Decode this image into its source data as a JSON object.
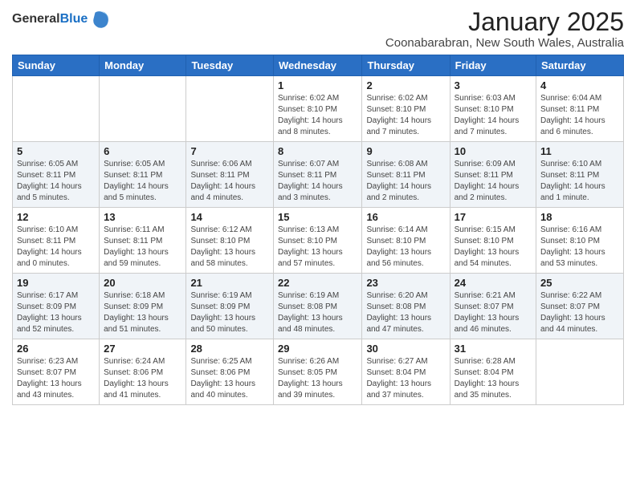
{
  "header": {
    "logo_general": "General",
    "logo_blue": "Blue",
    "month_title": "January 2025",
    "subtitle": "Coonabarabran, New South Wales, Australia"
  },
  "weekdays": [
    "Sunday",
    "Monday",
    "Tuesday",
    "Wednesday",
    "Thursday",
    "Friday",
    "Saturday"
  ],
  "weeks": [
    [
      {
        "day": "",
        "info": ""
      },
      {
        "day": "",
        "info": ""
      },
      {
        "day": "",
        "info": ""
      },
      {
        "day": "1",
        "info": "Sunrise: 6:02 AM\nSunset: 8:10 PM\nDaylight: 14 hours\nand 8 minutes."
      },
      {
        "day": "2",
        "info": "Sunrise: 6:02 AM\nSunset: 8:10 PM\nDaylight: 14 hours\nand 7 minutes."
      },
      {
        "day": "3",
        "info": "Sunrise: 6:03 AM\nSunset: 8:10 PM\nDaylight: 14 hours\nand 7 minutes."
      },
      {
        "day": "4",
        "info": "Sunrise: 6:04 AM\nSunset: 8:11 PM\nDaylight: 14 hours\nand 6 minutes."
      }
    ],
    [
      {
        "day": "5",
        "info": "Sunrise: 6:05 AM\nSunset: 8:11 PM\nDaylight: 14 hours\nand 5 minutes."
      },
      {
        "day": "6",
        "info": "Sunrise: 6:05 AM\nSunset: 8:11 PM\nDaylight: 14 hours\nand 5 minutes."
      },
      {
        "day": "7",
        "info": "Sunrise: 6:06 AM\nSunset: 8:11 PM\nDaylight: 14 hours\nand 4 minutes."
      },
      {
        "day": "8",
        "info": "Sunrise: 6:07 AM\nSunset: 8:11 PM\nDaylight: 14 hours\nand 3 minutes."
      },
      {
        "day": "9",
        "info": "Sunrise: 6:08 AM\nSunset: 8:11 PM\nDaylight: 14 hours\nand 2 minutes."
      },
      {
        "day": "10",
        "info": "Sunrise: 6:09 AM\nSunset: 8:11 PM\nDaylight: 14 hours\nand 2 minutes."
      },
      {
        "day": "11",
        "info": "Sunrise: 6:10 AM\nSunset: 8:11 PM\nDaylight: 14 hours\nand 1 minute."
      }
    ],
    [
      {
        "day": "12",
        "info": "Sunrise: 6:10 AM\nSunset: 8:11 PM\nDaylight: 14 hours\nand 0 minutes."
      },
      {
        "day": "13",
        "info": "Sunrise: 6:11 AM\nSunset: 8:11 PM\nDaylight: 13 hours\nand 59 minutes."
      },
      {
        "day": "14",
        "info": "Sunrise: 6:12 AM\nSunset: 8:10 PM\nDaylight: 13 hours\nand 58 minutes."
      },
      {
        "day": "15",
        "info": "Sunrise: 6:13 AM\nSunset: 8:10 PM\nDaylight: 13 hours\nand 57 minutes."
      },
      {
        "day": "16",
        "info": "Sunrise: 6:14 AM\nSunset: 8:10 PM\nDaylight: 13 hours\nand 56 minutes."
      },
      {
        "day": "17",
        "info": "Sunrise: 6:15 AM\nSunset: 8:10 PM\nDaylight: 13 hours\nand 54 minutes."
      },
      {
        "day": "18",
        "info": "Sunrise: 6:16 AM\nSunset: 8:10 PM\nDaylight: 13 hours\nand 53 minutes."
      }
    ],
    [
      {
        "day": "19",
        "info": "Sunrise: 6:17 AM\nSunset: 8:09 PM\nDaylight: 13 hours\nand 52 minutes."
      },
      {
        "day": "20",
        "info": "Sunrise: 6:18 AM\nSunset: 8:09 PM\nDaylight: 13 hours\nand 51 minutes."
      },
      {
        "day": "21",
        "info": "Sunrise: 6:19 AM\nSunset: 8:09 PM\nDaylight: 13 hours\nand 50 minutes."
      },
      {
        "day": "22",
        "info": "Sunrise: 6:19 AM\nSunset: 8:08 PM\nDaylight: 13 hours\nand 48 minutes."
      },
      {
        "day": "23",
        "info": "Sunrise: 6:20 AM\nSunset: 8:08 PM\nDaylight: 13 hours\nand 47 minutes."
      },
      {
        "day": "24",
        "info": "Sunrise: 6:21 AM\nSunset: 8:07 PM\nDaylight: 13 hours\nand 46 minutes."
      },
      {
        "day": "25",
        "info": "Sunrise: 6:22 AM\nSunset: 8:07 PM\nDaylight: 13 hours\nand 44 minutes."
      }
    ],
    [
      {
        "day": "26",
        "info": "Sunrise: 6:23 AM\nSunset: 8:07 PM\nDaylight: 13 hours\nand 43 minutes."
      },
      {
        "day": "27",
        "info": "Sunrise: 6:24 AM\nSunset: 8:06 PM\nDaylight: 13 hours\nand 41 minutes."
      },
      {
        "day": "28",
        "info": "Sunrise: 6:25 AM\nSunset: 8:06 PM\nDaylight: 13 hours\nand 40 minutes."
      },
      {
        "day": "29",
        "info": "Sunrise: 6:26 AM\nSunset: 8:05 PM\nDaylight: 13 hours\nand 39 minutes."
      },
      {
        "day": "30",
        "info": "Sunrise: 6:27 AM\nSunset: 8:04 PM\nDaylight: 13 hours\nand 37 minutes."
      },
      {
        "day": "31",
        "info": "Sunrise: 6:28 AM\nSunset: 8:04 PM\nDaylight: 13 hours\nand 35 minutes."
      },
      {
        "day": "",
        "info": ""
      }
    ]
  ]
}
